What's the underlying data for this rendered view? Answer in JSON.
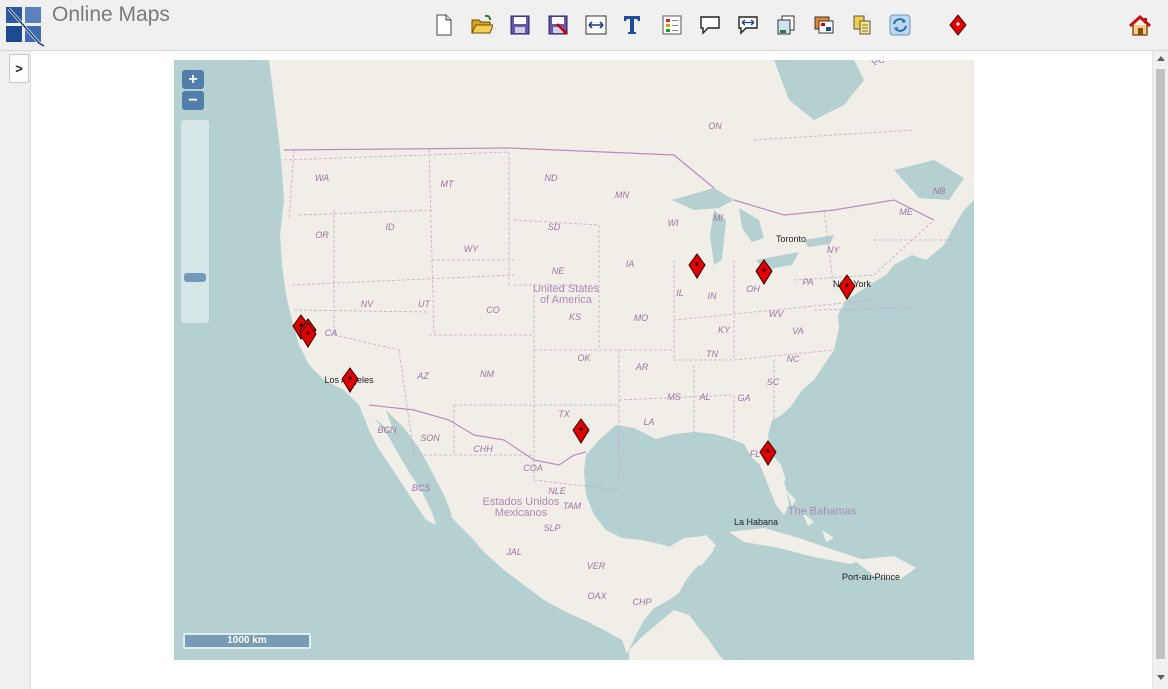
{
  "app": {
    "title": "Online Maps"
  },
  "toolbar": [
    {
      "name": "new-document-icon"
    },
    {
      "name": "open-folder-icon"
    },
    {
      "name": "save-icon"
    },
    {
      "name": "save-as-icon"
    },
    {
      "name": "resize-width-icon"
    },
    {
      "name": "text-tool-icon"
    },
    {
      "name": "legend-icon"
    },
    {
      "name": "speech-balloon-icon"
    },
    {
      "name": "balloon-resize-icon"
    },
    {
      "name": "copy-icon"
    },
    {
      "name": "layers-icon"
    },
    {
      "name": "multi-document-icon"
    },
    {
      "name": "refresh-icon"
    },
    {
      "name": "map-marker-tool-icon"
    }
  ],
  "sidebar": {
    "toggle_label": ">"
  },
  "map": {
    "zoom_in_label": "+",
    "zoom_out_label": "−",
    "scale_label": "1000 km",
    "colors": {
      "water": "#b5d0d0",
      "land": "#f1eee8",
      "marker": "#e00000"
    },
    "region_labels": [
      "WA",
      "MT",
      "ND",
      "MN",
      "OR",
      "ID",
      "SD",
      "WY",
      "WI",
      "MI",
      "NE",
      "IA",
      "NV",
      "UT",
      "CO",
      "KS",
      "IL",
      "IN",
      "OH",
      "PA",
      "NY",
      "CA",
      "MO",
      "KY",
      "WV",
      "VA",
      "AZ",
      "NM",
      "OK",
      "AR",
      "TN",
      "NC",
      "SC",
      "TX",
      "MS",
      "AL",
      "GA",
      "LA",
      "FL",
      "ON",
      "QC",
      "NB",
      "ME",
      "BCN",
      "SON",
      "CHH",
      "COA",
      "NLE",
      "TAM",
      "SLP",
      "BCS",
      "JAL",
      "VER",
      "OAX",
      "CHP"
    ],
    "place_labels": [
      "United States\nof America",
      "Estados Unidos\nMexicanos",
      "The Bahamas"
    ],
    "city_labels": [
      "Toronto",
      "New York",
      "Los Angeles",
      "La Habana",
      "Port-au-Prince"
    ],
    "markers": [
      {
        "name": "marker-san-francisco-1"
      },
      {
        "name": "marker-san-francisco-2"
      },
      {
        "name": "marker-san-jose"
      },
      {
        "name": "marker-los-angeles"
      },
      {
        "name": "marker-austin"
      },
      {
        "name": "marker-chicago"
      },
      {
        "name": "marker-columbus"
      },
      {
        "name": "marker-new-york"
      },
      {
        "name": "marker-florida"
      }
    ]
  }
}
